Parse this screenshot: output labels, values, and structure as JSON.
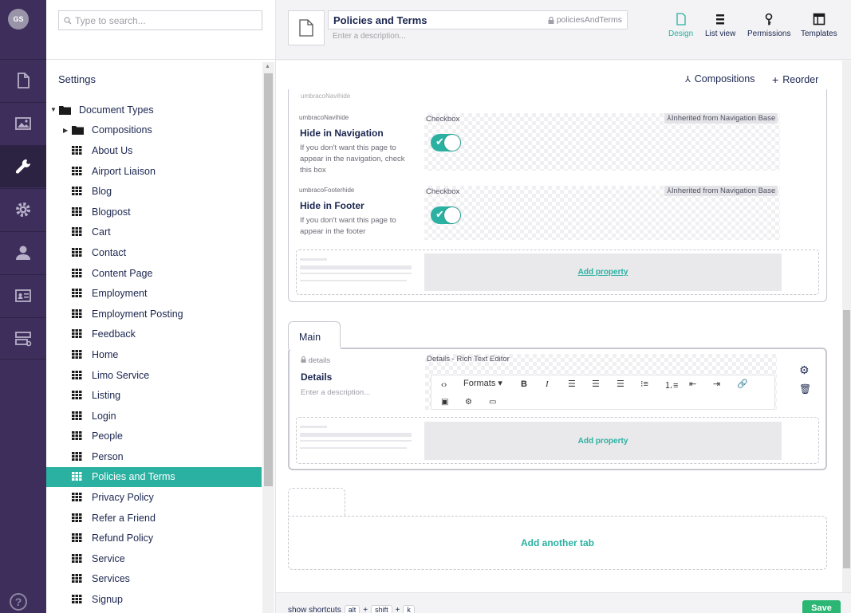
{
  "user": {
    "initials": "GS"
  },
  "search": {
    "placeholder": "Type to search..."
  },
  "tree": {
    "heading": "Settings",
    "root": "Document Types",
    "folder": "Compositions",
    "items": [
      "About Us",
      "Airport Liaison",
      "Blog",
      "Blogpost",
      "Cart",
      "Contact",
      "Content Page",
      "Employment",
      "Employment Posting",
      "Feedback",
      "Home",
      "Limo Service",
      "Listing",
      "Login",
      "People",
      "Person",
      "Policies and Terms",
      "Privacy Policy",
      "Refer a Friend",
      "Refund Policy",
      "Service",
      "Services",
      "Signup"
    ],
    "selected": "Policies and Terms"
  },
  "header": {
    "name": "Policies and Terms",
    "alias": "policiesAndTerms",
    "description_placeholder": "Enter a description...",
    "apps": [
      "Design",
      "List view",
      "Permissions",
      "Templates"
    ]
  },
  "toolbar": {
    "compositions": "Compositions",
    "reorder": "Reorder"
  },
  "group1": {
    "cut_alias": "umbracoNavihide",
    "props": [
      {
        "alias": "umbracoNavihide",
        "name": "Hide in Navigation",
        "desc": "If you don't want this page to appear in the navigation, check this box",
        "editor": "Checkbox",
        "inherited": "Inherited from Navigation Base"
      },
      {
        "alias": "umbracoFooterhide",
        "name": "Hide in Footer",
        "desc": "If you don't want this page to appear in the footer",
        "editor": "Checkbox",
        "inherited": "Inherited from Navigation Base"
      }
    ],
    "add_property": "Add property"
  },
  "group2": {
    "tab": "Main",
    "prop": {
      "alias": "details",
      "name": "Details",
      "desc": "Enter a description...",
      "editor": "Details - Rich Text Editor"
    },
    "formats": "Formats",
    "add_property": "Add property"
  },
  "add_tab": "Add another tab",
  "footer": {
    "show_shortcuts": "show shortcuts",
    "keys": [
      "alt",
      "shift",
      "k"
    ],
    "plus": "+",
    "save": "Save"
  },
  "colors": {
    "accent": "#2bb1a1",
    "rail": "#3d2e5c",
    "save": "#2bb673"
  }
}
